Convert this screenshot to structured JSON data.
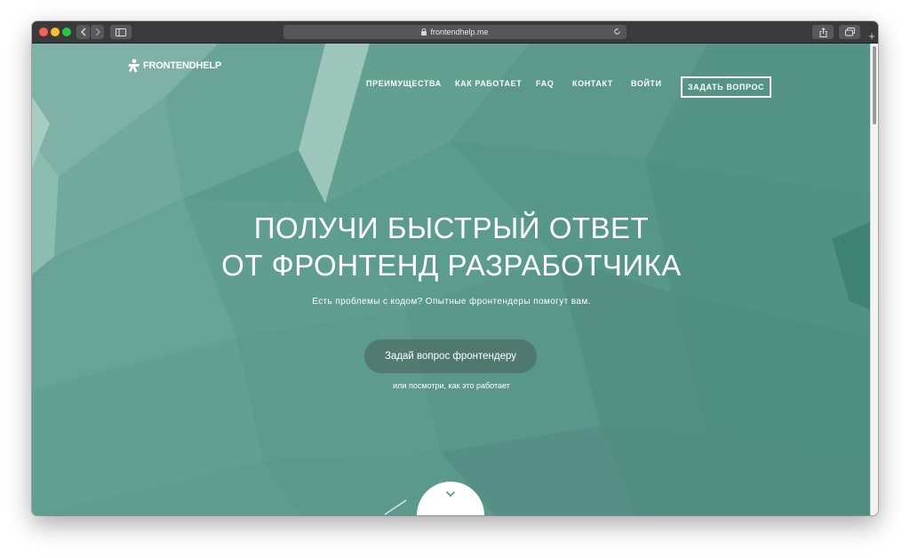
{
  "browser": {
    "url": "frontendhelp.me",
    "icons": {
      "back": "chevron-left-icon",
      "forward": "chevron-right-icon",
      "sidebar": "sidebar-icon",
      "lock": "lock-icon",
      "reload": "reload-icon",
      "share": "share-icon",
      "tabs": "tabs-icon",
      "new_tab": "plus-icon"
    },
    "new_tab_glyph": "+"
  },
  "site": {
    "logo_text": "FRONTENDHELP",
    "nav": [
      {
        "label": "ПРЕИМУЩЕСТВА"
      },
      {
        "label": "КАК РАБОТАЕТ"
      },
      {
        "label": "FAQ"
      },
      {
        "label": "КОНТАКТ"
      },
      {
        "label": "ВОЙТИ"
      }
    ],
    "ask_button": "ЗАДАТЬ ВОПРОС"
  },
  "hero": {
    "title_line1": "ПОЛУЧИ БЫСТРЫЙ ОТВЕТ",
    "title_line2": "ОТ ФРОНТЕНД РАЗРАБОТЧИКА",
    "subtitle": "Есть проблемы с кодом? Опытные фронтендеры помогут вам.",
    "cta_label": "Задай вопрос фронтендеру",
    "secondary_link": "или посмотри, как это работает"
  },
  "colors": {
    "hero_bg": "#5a9a8c",
    "titlebar": "#3a3a3c",
    "text": "#ffffff"
  }
}
